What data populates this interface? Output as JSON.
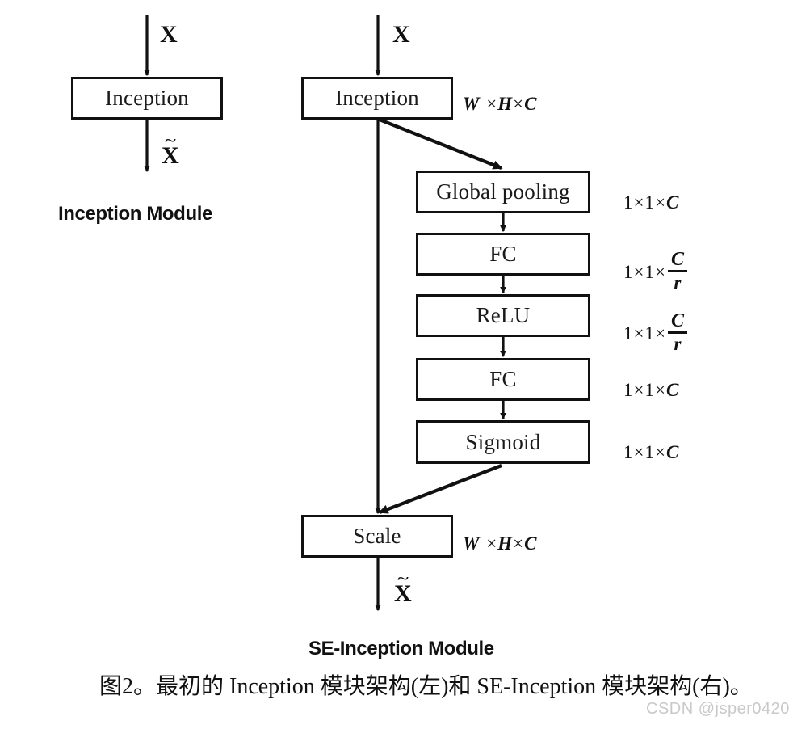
{
  "figure": {
    "caption": "图2。最初的 Inception 模块架构(左)和 SE-Inception 模块架构(右)。",
    "watermark": "CSDN @jsper0420",
    "background_color": "#ffffff",
    "stroke_color": "#111111"
  },
  "left_module": {
    "caption": "Inception Module",
    "input_symbol": "X",
    "output_symbol": "X",
    "output_has_tilde": true,
    "blocks": [
      {
        "label": "Inception"
      }
    ]
  },
  "right_module": {
    "caption": "SE-Inception Module",
    "input_symbol": "X",
    "output_symbol": "X",
    "output_has_tilde": true,
    "blocks": [
      {
        "label": "Inception"
      },
      {
        "label": "Global pooling"
      },
      {
        "label": "FC"
      },
      {
        "label": "ReLU"
      },
      {
        "label": "FC"
      },
      {
        "label": "Sigmoid"
      },
      {
        "label": "Scale"
      }
    ],
    "dimensions": {
      "after_inception": {
        "w": "W",
        "h": "H",
        "c": "C"
      },
      "after_global_pooling": {
        "a": "1",
        "b": "1",
        "c": "C"
      },
      "after_fc1": {
        "a": "1",
        "b": "1",
        "num": "C",
        "den": "r"
      },
      "after_relu": {
        "a": "1",
        "b": "1",
        "num": "C",
        "den": "r"
      },
      "after_fc2": {
        "a": "1",
        "b": "1",
        "c": "C"
      },
      "after_sigmoid": {
        "a": "1",
        "b": "1",
        "c": "C"
      },
      "after_scale": {
        "w": "W",
        "h": "H",
        "c": "C"
      }
    }
  },
  "glyphs": {
    "times": "×",
    "tilde": "~"
  }
}
